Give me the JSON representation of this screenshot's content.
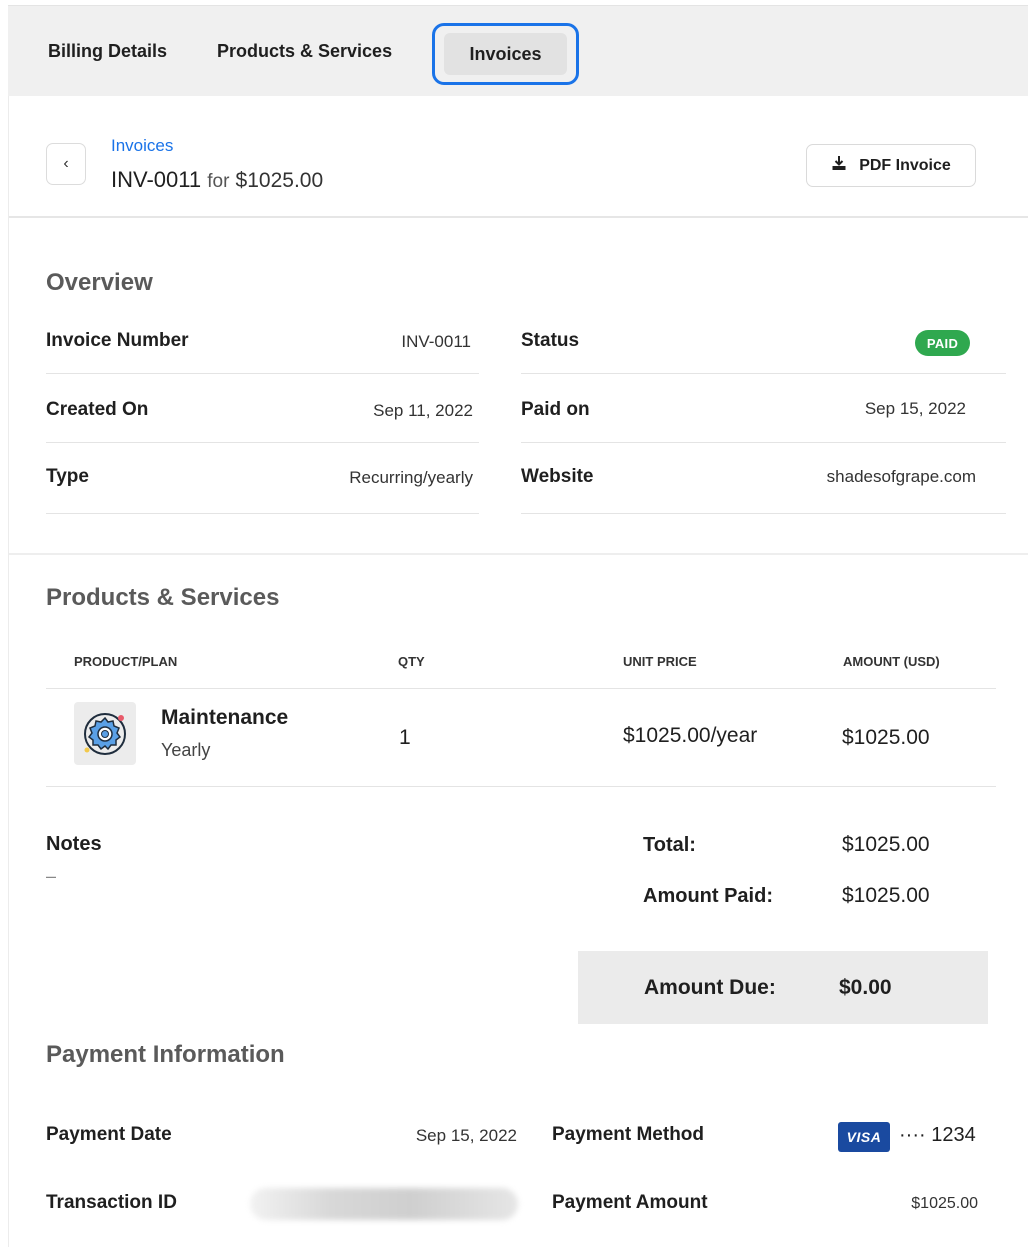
{
  "tabs": {
    "billing": "Billing Details",
    "products": "Products & Services",
    "invoices": "Invoices"
  },
  "header": {
    "breadcrumb": "Invoices",
    "invoice_number": "INV-0011",
    "for_text": "for",
    "amount": "$1025.00",
    "pdf_button": "PDF Invoice"
  },
  "overview": {
    "title": "Overview",
    "invoice_number_label": "Invoice Number",
    "invoice_number_value": "INV-0011",
    "status_label": "Status",
    "status_value": "PAID",
    "created_label": "Created On",
    "created_value": "Sep 11, 2022",
    "paid_label": "Paid on",
    "paid_value": "Sep 15, 2022",
    "type_label": "Type",
    "type_value": "Recurring/yearly",
    "website_label": "Website",
    "website_value": "shadesofgrape.com",
    "status_color": "#2fa84f"
  },
  "products": {
    "title": "Products & Services",
    "columns": [
      "PRODUCT/PLAN",
      "QTY",
      "UNIT PRICE",
      "AMOUNT (USD)"
    ],
    "rows": [
      {
        "name": "Maintenance",
        "plan": "Yearly",
        "qty": "1",
        "unit_price": "$1025.00/year",
        "amount": "$1025.00",
        "icon": "gear-icon"
      }
    ]
  },
  "summary": {
    "notes_label": "Notes",
    "notes_value": "–",
    "total_label": "Total:",
    "total_value": "$1025.00",
    "paid_label": "Amount Paid:",
    "paid_value": "$1025.00",
    "due_label": "Amount Due:",
    "due_value": "$0.00"
  },
  "payment": {
    "title": "Payment Information",
    "date_label": "Payment Date",
    "date_value": "Sep 15, 2022",
    "method_label": "Payment Method",
    "card_brand": "VISA",
    "card_number": "···· 1234",
    "txn_label": "Transaction ID",
    "amount_label": "Payment Amount",
    "amount_value": "$1025.00"
  },
  "colors": {
    "accent": "#1a73e8",
    "visa_blue": "#1a4aa0"
  }
}
